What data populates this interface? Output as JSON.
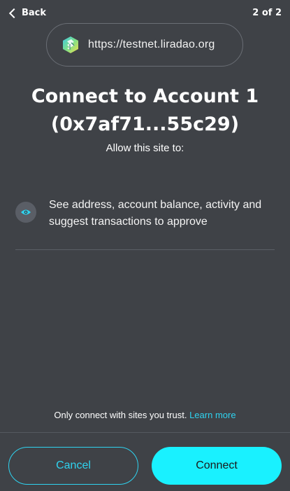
{
  "nav": {
    "back_label": "Back",
    "step_label": "2 of 2"
  },
  "origin": {
    "url": "https://testnet.liradao.org",
    "icon": "liradao-logo-icon"
  },
  "heading": {
    "title_line1": "Connect to Account 1",
    "title_line2": "(0x7af71...55c29)",
    "subtitle": "Allow this site to:"
  },
  "permissions": [
    {
      "icon": "eye-icon",
      "text": "See address, account balance, activity and suggest transactions to approve"
    }
  ],
  "footer": {
    "trust_text": "Only connect with sites you trust.",
    "learn_more": "Learn more",
    "cancel_label": "Cancel",
    "connect_label": "Connect"
  },
  "colors": {
    "background": "#3f4247",
    "accent": "#2fd3f0",
    "primary_button": "#19f1ff"
  }
}
